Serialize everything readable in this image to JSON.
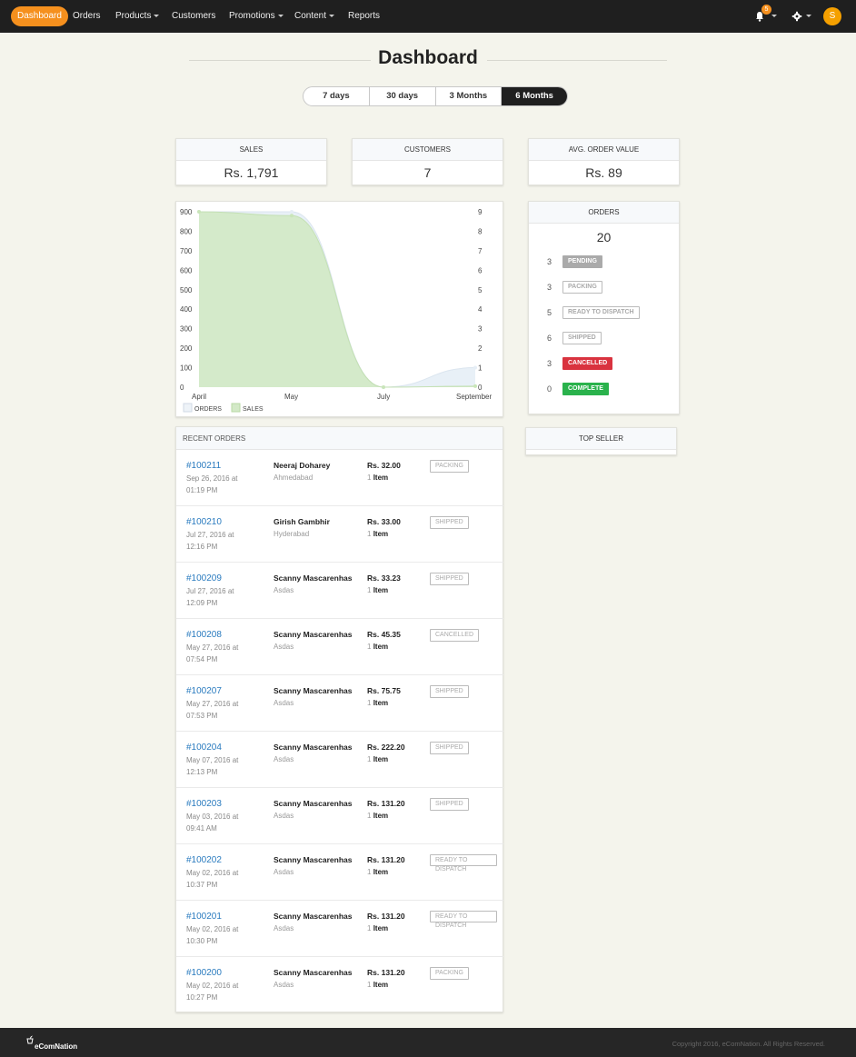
{
  "nav": {
    "items": [
      {
        "label": "Dashboard",
        "active": true,
        "caret": false
      },
      {
        "label": "Orders",
        "caret": false
      },
      {
        "label": "Products",
        "caret": true
      },
      {
        "label": "Customers",
        "caret": false
      },
      {
        "label": "Promotions",
        "caret": true
      },
      {
        "label": "Content",
        "caret": true
      },
      {
        "label": "Reports",
        "caret": false
      }
    ],
    "notification_count": "5",
    "avatar_initial": "S"
  },
  "page": {
    "title": "Dashboard",
    "ranges": [
      "7 days",
      "30 days",
      "3 Months",
      "6 Months"
    ],
    "selected_range": "6 Months"
  },
  "stats": {
    "sales": {
      "label": "SALES",
      "value": "Rs. 1,791"
    },
    "customers": {
      "label": "CUSTOMERS",
      "value": "7"
    },
    "aov": {
      "label": "AVG. ORDER VALUE",
      "value": "Rs. 89"
    }
  },
  "chart_data": {
    "type": "area",
    "categories": [
      "April",
      "May",
      "July",
      "September"
    ],
    "series": [
      {
        "name": "ORDERS",
        "axis": "right",
        "values": [
          9,
          9,
          0,
          1
        ],
        "color": "#e6eef6"
      },
      {
        "name": "SALES",
        "axis": "left",
        "values": [
          900,
          880,
          0,
          5
        ],
        "color": "#d3e9c7"
      }
    ],
    "left_ticks": [
      "0",
      "100",
      "200",
      "300",
      "400",
      "500",
      "600",
      "700",
      "800",
      "900"
    ],
    "right_ticks": [
      "0",
      "1",
      "2",
      "3",
      "4",
      "5",
      "6",
      "7",
      "8",
      "9"
    ],
    "ylim_left": [
      0,
      900
    ],
    "ylim_right": [
      0,
      9
    ],
    "legend": "bottom-left"
  },
  "orders_summary": {
    "label": "ORDERS",
    "total": "20",
    "statuses": [
      {
        "count": "3",
        "label": "PENDING",
        "style": "pending"
      },
      {
        "count": "3",
        "label": "PACKING",
        "style": "outline"
      },
      {
        "count": "5",
        "label": "READY TO DISPATCH",
        "style": "outline"
      },
      {
        "count": "6",
        "label": "SHIPPED",
        "style": "outline"
      },
      {
        "count": "3",
        "label": "CANCELLED",
        "style": "cancelled"
      },
      {
        "count": "0",
        "label": "COMPLETE",
        "style": "complete"
      }
    ]
  },
  "top_seller": {
    "label": "TOP SELLER"
  },
  "recent_orders": {
    "label": "RECENT ORDERS",
    "rows": [
      {
        "id": "#100211",
        "date": "Sep 26, 2016 at",
        "time": "01:19 PM",
        "name": "Neeraj Doharey",
        "city": "Ahmedabad",
        "price": "Rs. 32.00",
        "qty": "1",
        "unit": "Item",
        "status": "PACKING"
      },
      {
        "id": "#100210",
        "date": "Jul 27, 2016 at",
        "time": "12:16 PM",
        "name": "Girish Gambhir",
        "city": "Hyderabad",
        "price": "Rs. 33.00",
        "qty": "1",
        "unit": "Item",
        "status": "SHIPPED"
      },
      {
        "id": "#100209",
        "date": "Jul 27, 2016 at",
        "time": "12:09 PM",
        "name": "Scanny Mascarenhas",
        "city": "Asdas",
        "price": "Rs. 33.23",
        "qty": "1",
        "unit": "Item",
        "status": "SHIPPED"
      },
      {
        "id": "#100208",
        "date": "May 27, 2016 at",
        "time": "07:54 PM",
        "name": "Scanny Mascarenhas",
        "city": "Asdas",
        "price": "Rs. 45.35",
        "qty": "1",
        "unit": "Item",
        "status": "CANCELLED"
      },
      {
        "id": "#100207",
        "date": "May 27, 2016 at",
        "time": "07:53 PM",
        "name": "Scanny Mascarenhas",
        "city": "Asdas",
        "price": "Rs. 75.75",
        "qty": "1",
        "unit": "Item",
        "status": "SHIPPED"
      },
      {
        "id": "#100204",
        "date": "May 07, 2016 at",
        "time": "12:13 PM",
        "name": "Scanny Mascarenhas",
        "city": "Asdas",
        "price": "Rs. 222.20",
        "qty": "1",
        "unit": "Item",
        "status": "SHIPPED"
      },
      {
        "id": "#100203",
        "date": "May 03, 2016 at",
        "time": "09:41 AM",
        "name": "Scanny Mascarenhas",
        "city": "Asdas",
        "price": "Rs. 131.20",
        "qty": "1",
        "unit": "Item",
        "status": "SHIPPED"
      },
      {
        "id": "#100202",
        "date": "May 02, 2016 at",
        "time": "10:37 PM",
        "name": "Scanny Mascarenhas",
        "city": "Asdas",
        "price": "Rs. 131.20",
        "qty": "1",
        "unit": "Item",
        "status": "READY TO DISPATCH"
      },
      {
        "id": "#100201",
        "date": "May 02, 2016 at",
        "time": "10:30 PM",
        "name": "Scanny Mascarenhas",
        "city": "Asdas",
        "price": "Rs. 131.20",
        "qty": "1",
        "unit": "Item",
        "status": "READY TO DISPATCH"
      },
      {
        "id": "#100200",
        "date": "May 02, 2016 at",
        "time": "10:27 PM",
        "name": "Scanny Mascarenhas",
        "city": "Asdas",
        "price": "Rs. 131.20",
        "qty": "1",
        "unit": "Item",
        "status": "PACKING"
      }
    ]
  },
  "footer": {
    "logo_text": "eComNation",
    "copyright": "Copyright 2016, eComNation. All Rights Reserved."
  },
  "colors": {
    "accent": "#f5901e",
    "nav_bg": "#1f1f1f",
    "link": "#2a7bbf",
    "cancelled": "#d9333f",
    "complete": "#2ab24c"
  }
}
